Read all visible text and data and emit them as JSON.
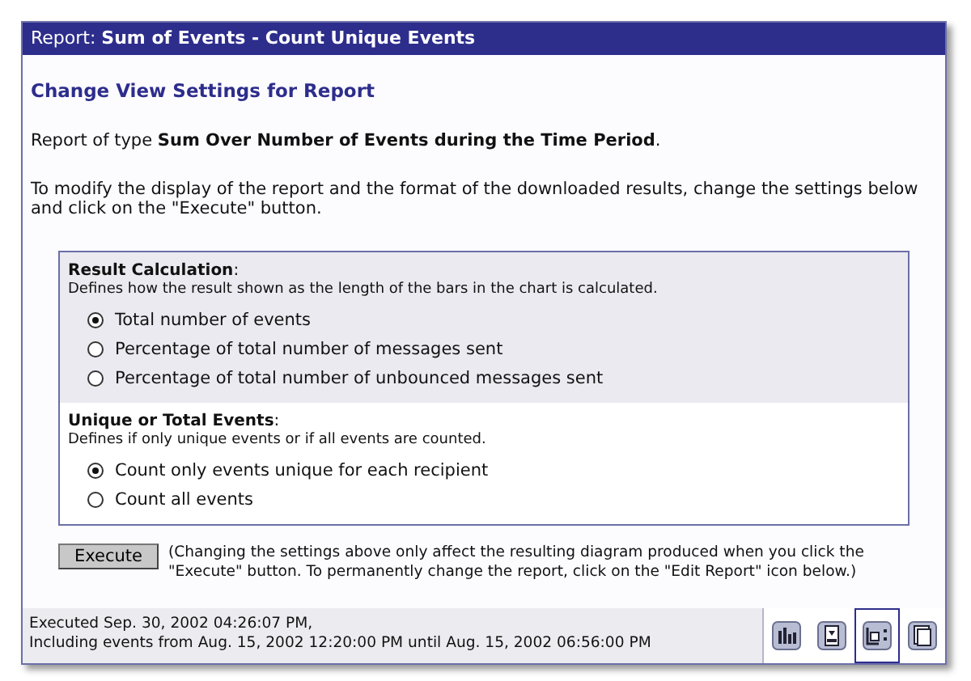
{
  "window": {
    "title": "Report: **Sum of Events - Count Unique Events**"
  },
  "heading": "Change View Settings for Report",
  "report_type": "Report of type **Sum Over Number of Events during the Time Period**.",
  "instructions": "To modify the display of the report and the format of the downloaded results, change the settings below and click on the \"Execute\" button.",
  "settings": [
    {
      "title": "**Result Calculation**:",
      "description": "Defines how the result shown as the length of the bars in the chart is calculated.",
      "shaded": true,
      "options": [
        {
          "label": "Total number of events",
          "selected": true
        },
        {
          "label": "Percentage of total number of messages sent",
          "selected": false
        },
        {
          "label": "Percentage of total number of unbounced messages sent",
          "selected": false
        }
      ]
    },
    {
      "title": "**Unique or Total Events**:",
      "description": "Defines if only unique events or if all events are counted.",
      "shaded": false,
      "options": [
        {
          "label": "Count only events unique for each recipient",
          "selected": true
        },
        {
          "label": "Count all events",
          "selected": false
        }
      ]
    }
  ],
  "execute_button": "Execute",
  "execute_note": "(Changing the settings above only affect the resulting diagram produced when you click the \"Execute\" button. To permanently change the report, click on the \"Edit Report\" icon below.)",
  "status": [
    "Executed Sep. 30, 2002 04:26:07 PM,",
    "Including events from Aug. 15, 2002 12:20:00 PM until Aug. 15, 2002 06:56:00 PM"
  ],
  "toolbar": [
    {
      "kind": "chart",
      "selected": false
    },
    {
      "kind": "download",
      "selected": false
    },
    {
      "kind": "settings",
      "selected": true
    },
    {
      "kind": "copy",
      "selected": false
    }
  ]
}
